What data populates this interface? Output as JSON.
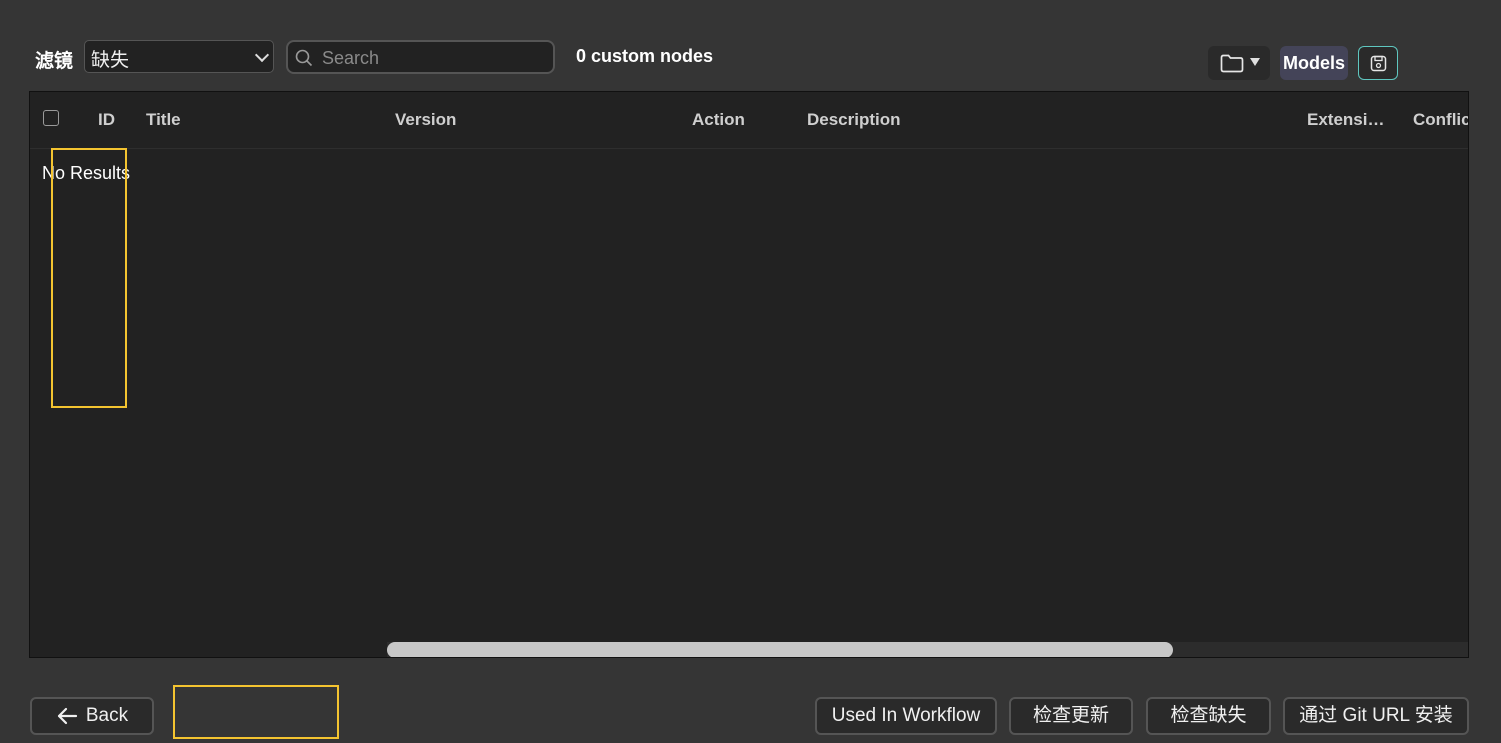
{
  "toolbar": {
    "filter_label": "滤镜",
    "filter_value": "缺失",
    "search_placeholder": "Search",
    "search_value": "",
    "node_count": "0 custom nodes",
    "folder_icon": "folder-icon",
    "models_label": "Models",
    "save_icon": "save-icon"
  },
  "grid": {
    "columns": [
      "ID",
      "Title",
      "Version",
      "Action",
      "Description",
      "Extensi…",
      "Conflic"
    ],
    "empty_message": "No Results"
  },
  "footer": {
    "back_label": "Back",
    "used_in_workflow_label": "Used In Workflow",
    "check_update_label": "检查更新",
    "check_missing_label": "检查缺失",
    "install_git_url_label": "通过 Git URL 安装"
  },
  "colors": {
    "background": "#353535",
    "grid_background": "#222222",
    "highlight": "#f4c430",
    "accent": "#5fc7c0"
  }
}
